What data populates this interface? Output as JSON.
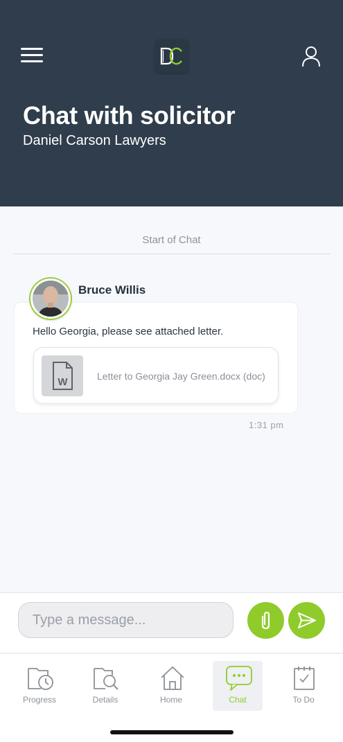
{
  "header": {
    "title": "Chat with solicitor",
    "subtitle": "Daniel Carson Lawyers"
  },
  "chat": {
    "start_label": "Start of Chat",
    "message": {
      "sender": "Bruce Willis",
      "text": "Hello Georgia, please see attached letter.",
      "attachment_name": "Letter to Georgia Jay Green.docx (doc)",
      "time": "1:31 pm"
    }
  },
  "composer": {
    "placeholder": "Type a message..."
  },
  "tabs": [
    {
      "label": "Progress",
      "icon": "progress-icon"
    },
    {
      "label": "Details",
      "icon": "details-icon"
    },
    {
      "label": "Home",
      "icon": "home-icon"
    },
    {
      "label": "Chat",
      "icon": "chat-icon",
      "active": true
    },
    {
      "label": "To Do",
      "icon": "todo-icon"
    }
  ],
  "colors": {
    "header_bg": "#2f3d4c",
    "accent": "#8fcb2b",
    "background": "#f7f8fb"
  }
}
